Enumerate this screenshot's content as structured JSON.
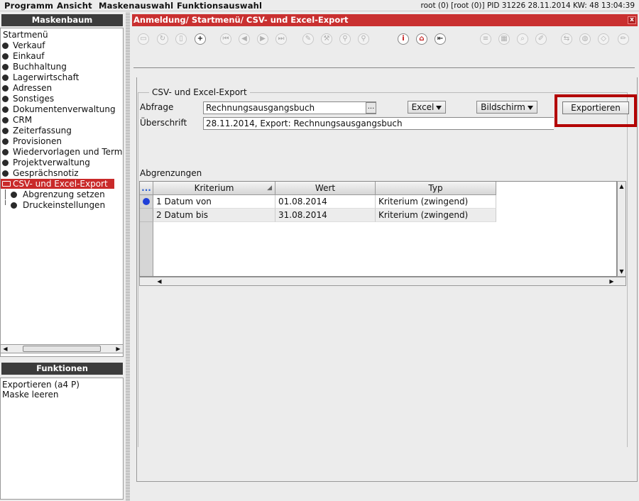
{
  "menubar": {
    "items": [
      "Programm",
      "Ansicht",
      "Maskenauswahl",
      "Funktionsauswahl"
    ],
    "status": "root (0) [root (0)] PID 31226  28.11.2014 KW: 48  13:04:39"
  },
  "left": {
    "tree_header": "Maskenbaum",
    "tree_items": [
      "Startmenü",
      "Verkauf",
      "Einkauf",
      "Buchhaltung",
      "Lagerwirtschaft",
      "Adressen",
      "Sonstiges",
      "Dokumentenverwaltung",
      "CRM",
      "Zeiterfassung",
      "Provisionen",
      "Wiedervorlagen und Termine",
      "Projektverwaltung",
      "Gesprächsnotiz",
      "CSV- und Excel-Export",
      "Abgrenzung setzen",
      "Druckeinstellungen"
    ],
    "functions_header": "Funktionen",
    "functions": [
      "Exportieren (a4 P)",
      "Maske leeren"
    ]
  },
  "window": {
    "title": "Anmeldung/ Startmenü/ CSV- und Excel-Export",
    "close": "x"
  },
  "toolbar_icons": [
    "window-icon",
    "refresh-icon",
    "trash-icon",
    "plus-icon",
    "first-icon",
    "prev-icon",
    "next-icon",
    "last-icon",
    "edit-icon",
    "tools-icon",
    "search-pair-icon",
    "search-pair-alt-icon",
    "info-icon",
    "home-icon",
    "exit-icon",
    "list-icon",
    "calendar-icon",
    "magnifier-icon",
    "convert-icon",
    "stamp-icon",
    "tag-icon"
  ],
  "form": {
    "group_title": "CSV- und Excel-Export",
    "query_label": "Abfrage",
    "query_value": "Rechnungsausgangsbuch",
    "browse_label": "...",
    "format_value": "Excel",
    "output_value": "Bildschirm",
    "export_label": "Exportieren",
    "heading_label": "Überschrift",
    "heading_value": "28.11.2014, Export: Rechnungsausgangsbuch"
  },
  "limits": {
    "title": "Abgrenzungen",
    "corner": "...",
    "columns": [
      "Kriterium",
      "Wert",
      "Typ"
    ],
    "rows": [
      {
        "kriterium": "1 Datum von",
        "wert": "01.08.2014",
        "typ": "Kriterium (zwingend)"
      },
      {
        "kriterium": "2 Datum bis",
        "wert": "31.08.2014",
        "typ": "Kriterium (zwingend)"
      }
    ]
  },
  "colors": {
    "accent": "#c93030",
    "header_dark": "#3c3c3c",
    "highlight": "#b30000"
  }
}
